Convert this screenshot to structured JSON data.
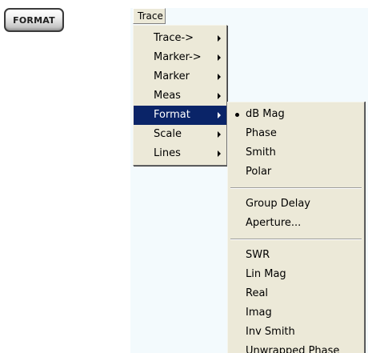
{
  "hardkey": {
    "label": "FORMAT"
  },
  "menubar": {
    "trace_label": "Trace"
  },
  "trace_menu": {
    "items": [
      {
        "label": "Trace->",
        "submenu": true
      },
      {
        "label": "Marker->",
        "submenu": true
      },
      {
        "label": "Marker",
        "submenu": true
      },
      {
        "label": "Meas",
        "submenu": true
      },
      {
        "label": "Format",
        "submenu": true,
        "highlighted": true
      },
      {
        "label": "Scale",
        "submenu": true
      },
      {
        "label": "Lines",
        "submenu": true
      }
    ]
  },
  "format_menu": {
    "selected": "dB Mag",
    "group1": [
      "dB Mag",
      "Phase",
      "Smith",
      "Polar"
    ],
    "group2": [
      "Group Delay",
      "Aperture..."
    ],
    "group3": [
      "SWR",
      "Lin Mag",
      "Real",
      "Imag",
      "Inv Smith",
      "Unwrapped Phase"
    ]
  },
  "colors": {
    "menu_bg": "#ece9d8",
    "highlight_bg": "#0a2468",
    "highlight_text": "#ffffff",
    "app_bg": "#f3fafd"
  }
}
